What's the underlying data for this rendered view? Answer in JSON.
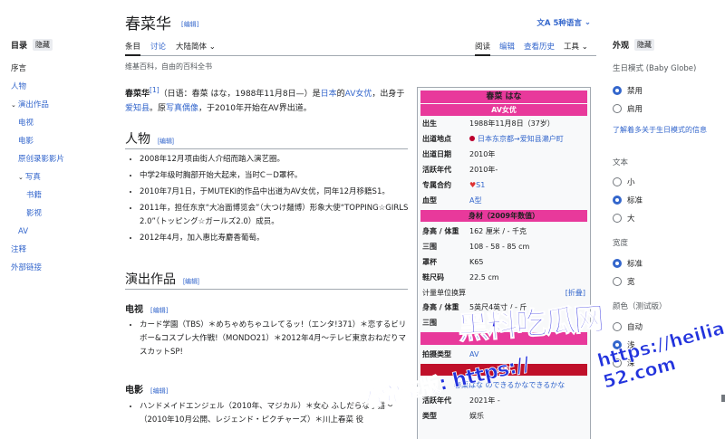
{
  "toc": {
    "title": "目录",
    "hide": "隐藏",
    "items": [
      {
        "label": "序言",
        "level": 1,
        "active": true
      },
      {
        "label": "人物",
        "level": 1
      },
      {
        "label": "演出作品",
        "level": 1,
        "caret": true
      },
      {
        "label": "电视",
        "level": 2
      },
      {
        "label": "电影",
        "level": 2
      },
      {
        "label": "原创录影影片",
        "level": 2
      },
      {
        "label": "写真",
        "level": 2,
        "caret": true
      },
      {
        "label": "书籍",
        "level": 3
      },
      {
        "label": "影视",
        "level": 3
      },
      {
        "label": "AV",
        "level": 2
      },
      {
        "label": "注释",
        "level": 1
      },
      {
        "label": "外部链接",
        "level": 1
      }
    ]
  },
  "page": {
    "title": "春菜华",
    "edit": "[编辑]",
    "languages": "5种语言",
    "subtitle": "维基百科，自由的百科全书"
  },
  "tabs": {
    "article": "条目",
    "talk": "讨论",
    "variant": "大陆简体",
    "read": "阅读",
    "edit": "编辑",
    "history": "查看历史",
    "tools": "工具"
  },
  "lead": {
    "name": "春菜华",
    "ref": "[1]",
    "text1": "（日语：春菜 はな，1988年11月8日—）是",
    "link1": "日本",
    "text2": "的",
    "link2": "AV女优",
    "text3": "，出身于",
    "link3": "爱知县",
    "text4": "。原",
    "link4": "写真偶像",
    "text5": "，于2010年开始在AV界出道。"
  },
  "sections": {
    "person": {
      "title": "人物",
      "edit": "[编辑]",
      "bullets": [
        "2008年12月项由街人介绍而踏入演艺圈。",
        "中学2年级时胸部开始大起来，当时C－D罩杯。",
        "2010年7月1日，于MUTEKI的作品中出道为AV女优，同年12月移籍S1。",
        "2011年，担任东京“大冶面博览会”（大つけ麺博）形象大使“TOPPING☆GIRLS 2.0”（トッピング☆ガールズ2.0）成员。",
        "2012年4月，加入惠比寿麝香葡萄。"
      ]
    },
    "works": {
      "title": "演出作品",
      "edit": "[编辑]"
    },
    "tv": {
      "title": "电视",
      "edit": "[编辑]",
      "bullets": [
        "カード学園（TBS）＊めちゃめちゃユレてるッ!（エンタ!371）＊恋するビリボー&コスプレ大作戦!（MONDO21）＊2012年4月〜テレビ東京おねだりマスカットSP!"
      ]
    },
    "movie": {
      "title": "电影",
      "edit": "[编辑]",
      "bullets": [
        "ハンドメイドエンジェル（2010年、マジカル）＊女心 ふしだらな子猫〜（2010年10月公開、レジェンド・ピクチャーズ）＊川上春菜 役"
      ]
    }
  },
  "infobox": {
    "name": "春菜 はな",
    "subtitle": "AV女优",
    "rows": [
      {
        "k": "出生",
        "v": "1988年11月8日（37岁）"
      },
      {
        "k": "出道地点",
        "v": "日本东京都→爱知县濑户町",
        "flag": true
      },
      {
        "k": "出道日期",
        "v": "2010年"
      },
      {
        "k": "活跃年代",
        "v": "2010年-"
      },
      {
        "k": "专属合约",
        "v": "S1",
        "heart": true
      },
      {
        "k": "血型",
        "v": "A型"
      }
    ],
    "body_header": "身材（2009年数值）",
    "body_rows": [
      {
        "k": "身高 / 体重",
        "v": "162 厘米 / - 千克"
      },
      {
        "k": "三围",
        "v": "108 - 58 - 85 cm"
      },
      {
        "k": "罩杯",
        "v": "K65"
      },
      {
        "k": "鞋尺码",
        "v": "22.5 cm"
      }
    ],
    "unit_label": "计量单位换算",
    "unit_toggle": "[折叠]",
    "unit_rows": [
      {
        "k": "身高 / 体重",
        "v": "5英尺4英寸 / - 斤"
      },
      {
        "k": "三围",
        "v": ""
      }
    ],
    "shoot_row": {
      "k": "拍摄类型",
      "v": "AV"
    },
    "red_header": "资料",
    "work_link": "春菜はな のできるかなできるかな",
    "extra_rows": [
      {
        "k": "活跃年代",
        "v": "2021年 -"
      },
      {
        "k": "类型",
        "v": "娱乐"
      }
    ]
  },
  "appearance": {
    "title": "外观",
    "hide": "隐藏",
    "skin_label": "生日模式 (Baby Globe)",
    "skin_options": [
      "禁用",
      "启用"
    ],
    "learn_more": "了解着多关于生日模式的信息",
    "text_label": "文本",
    "text_options": [
      "小",
      "标准",
      "大"
    ],
    "width_label": "宽度",
    "width_options": [
      "标准",
      "宽"
    ],
    "color_label": "颜色（测试版）",
    "color_options": [
      "自动",
      "浅",
      "深"
    ]
  },
  "watermark": {
    "brand": "黑料吃瓜网",
    "url": "https://heiliao-52.com",
    "notice": "看完整版: https://"
  },
  "colors": {
    "link": "#3366cc",
    "accent": "#e8399b",
    "red": "#c0102a"
  }
}
